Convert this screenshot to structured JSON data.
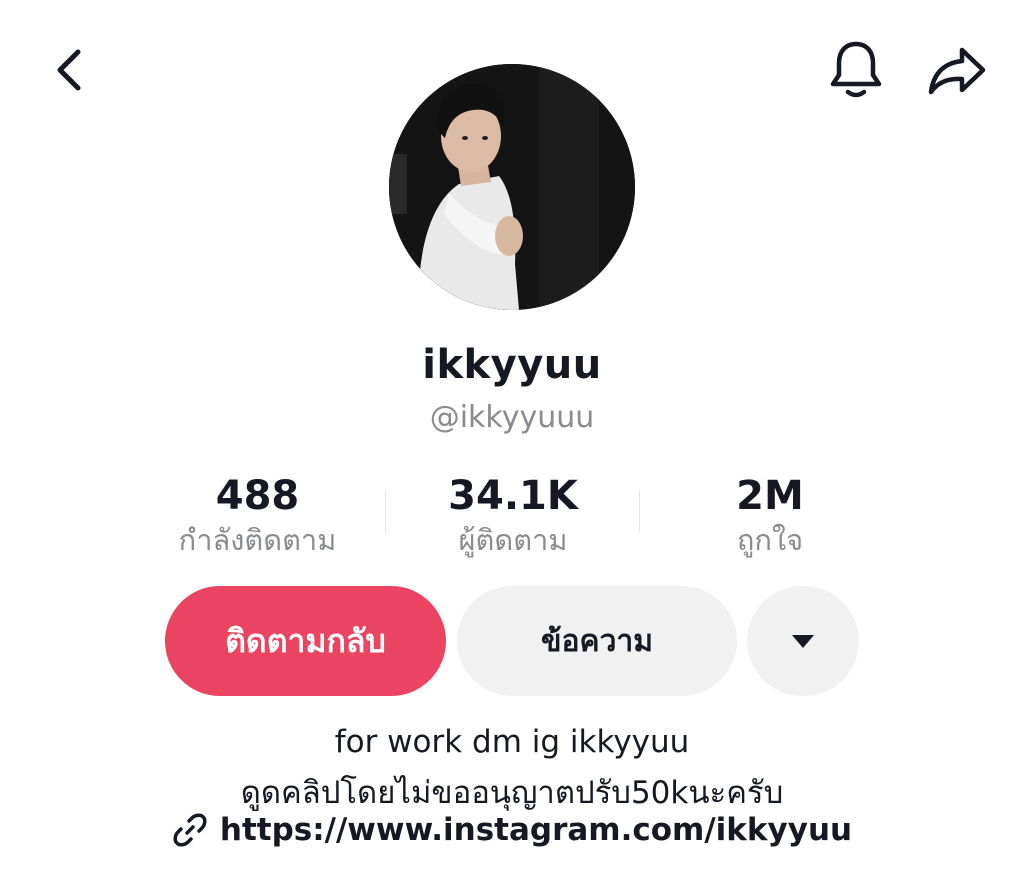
{
  "header": {
    "back_icon": "chevron-left-icon",
    "bell_icon": "bell-icon",
    "share_icon": "share-arrow-icon"
  },
  "profile": {
    "avatar": "profile-photo",
    "display_name": "ikkyyuu",
    "username": "@ikkyyuuu"
  },
  "stats": [
    {
      "value": "488",
      "label": "กำลังติดตาม"
    },
    {
      "value": "34.1K",
      "label": "ผู้ติดตาม"
    },
    {
      "value": "2M",
      "label": "ถูกใจ"
    }
  ],
  "actions": {
    "follow_back_label": "ติดตามกลับ",
    "message_label": "ข้อความ",
    "more_icon": "caret-down-icon"
  },
  "bio": {
    "line1": "for work dm ig ikkyyuu",
    "line2": "ดูดคลิปโดยไม่ขออนุญาตปรับ50kนะครับ",
    "link_icon": "link-icon",
    "link": "https://www.instagram.com/ikkyyuu"
  },
  "colors": {
    "accent": "#ea4461",
    "text": "#161823",
    "muted": "#8a8b91",
    "button_gray": "#f1f1f2"
  }
}
